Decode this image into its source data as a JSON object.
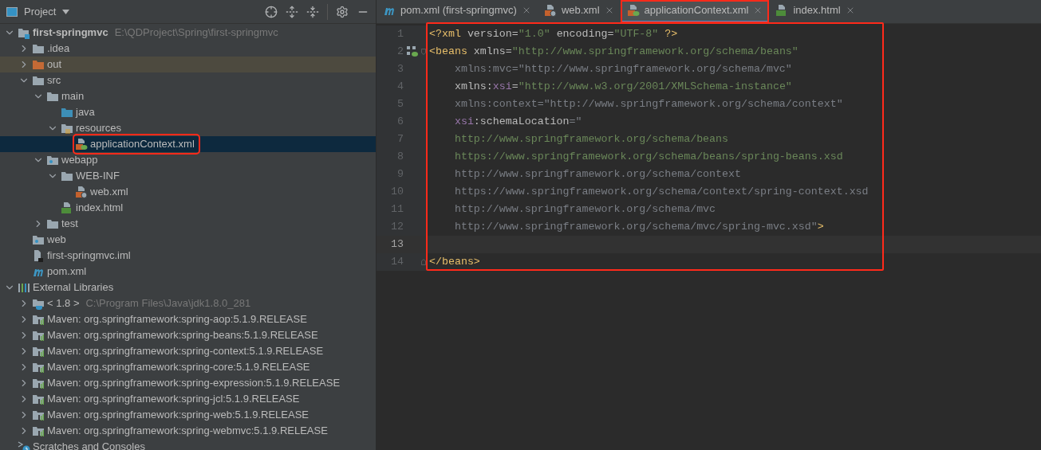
{
  "project_panel": {
    "title": "Project",
    "tree": [
      {
        "label": "first-springmvc",
        "detail": "E:\\QDProject\\Spring\\first-springmvc",
        "kind": "project",
        "bold": true,
        "expanded": true,
        "selected": false,
        "children": [
          {
            "label": ".idea",
            "kind": "folder",
            "expanded": false,
            "selected": false
          },
          {
            "label": "out",
            "kind": "folder-orange",
            "expanded": false,
            "excluded": true,
            "selected": false
          },
          {
            "label": "src",
            "kind": "folder",
            "expanded": true,
            "selected": false,
            "children": [
              {
                "label": "main",
                "kind": "folder",
                "expanded": true,
                "selected": false,
                "children": [
                  {
                    "label": "java",
                    "kind": "folder-blue",
                    "selected": false
                  },
                  {
                    "label": "resources",
                    "kind": "resources",
                    "expanded": true,
                    "selected": false,
                    "children": [
                      {
                        "label": "applicationContext.xml",
                        "kind": "xml-spring",
                        "selected": true,
                        "annotated": true
                      }
                    ]
                  }
                ]
              },
              {
                "label": "webapp",
                "kind": "web-folder",
                "expanded": true,
                "selected": false,
                "children": [
                  {
                    "label": "WEB-INF",
                    "kind": "folder",
                    "expanded": true,
                    "selected": false,
                    "children": [
                      {
                        "label": "web.xml",
                        "kind": "xml-web",
                        "selected": false
                      }
                    ]
                  },
                  {
                    "label": "index.html",
                    "kind": "html",
                    "selected": false
                  }
                ]
              },
              {
                "label": "test",
                "kind": "folder",
                "expanded": false,
                "selected": false
              }
            ]
          },
          {
            "label": "web",
            "kind": "web-folder",
            "selected": false
          },
          {
            "label": "first-springmvc.iml",
            "kind": "iml",
            "selected": false
          },
          {
            "label": "pom.xml",
            "kind": "maven",
            "selected": false
          }
        ]
      },
      {
        "label": "External Libraries",
        "kind": "libraries",
        "expanded": true,
        "selected": false,
        "children": [
          {
            "label": "< 1.8 >",
            "detail": "C:\\Program Files\\Java\\jdk1.8.0_281",
            "kind": "jdk",
            "expanded": false,
            "selected": false
          },
          {
            "label": "Maven: org.springframework:spring-aop:5.1.9.RELEASE",
            "kind": "library",
            "expanded": false,
            "selected": false
          },
          {
            "label": "Maven: org.springframework:spring-beans:5.1.9.RELEASE",
            "kind": "library",
            "expanded": false,
            "selected": false
          },
          {
            "label": "Maven: org.springframework:spring-context:5.1.9.RELEASE",
            "kind": "library",
            "expanded": false,
            "selected": false
          },
          {
            "label": "Maven: org.springframework:spring-core:5.1.9.RELEASE",
            "kind": "library",
            "expanded": false,
            "selected": false
          },
          {
            "label": "Maven: org.springframework:spring-expression:5.1.9.RELEASE",
            "kind": "library",
            "expanded": false,
            "selected": false
          },
          {
            "label": "Maven: org.springframework:spring-jcl:5.1.9.RELEASE",
            "kind": "library",
            "expanded": false,
            "selected": false
          },
          {
            "label": "Maven: org.springframework:spring-web:5.1.9.RELEASE",
            "kind": "library",
            "expanded": false,
            "selected": false
          },
          {
            "label": "Maven: org.springframework:spring-webmvc:5.1.9.RELEASE",
            "kind": "library",
            "expanded": false,
            "selected": false
          }
        ]
      },
      {
        "label": "Scratches and Consoles",
        "kind": "scratches",
        "selected": false
      }
    ]
  },
  "editor": {
    "annotated": true,
    "tabs": [
      {
        "label": "pom.xml (first-springmvc)",
        "kind": "maven",
        "selected": false,
        "annotated": false
      },
      {
        "label": "web.xml",
        "kind": "xml-web",
        "selected": false,
        "annotated": false
      },
      {
        "label": "applicationContext.xml",
        "kind": "xml-spring",
        "selected": true,
        "annotated": true
      },
      {
        "label": "index.html",
        "kind": "html",
        "selected": false,
        "annotated": false
      }
    ],
    "lines": [
      {
        "number": "1",
        "current": false,
        "tokens": [
          {
            "kind": "tag",
            "text": "<?xml "
          },
          {
            "kind": "attr",
            "text": "version="
          },
          {
            "kind": "value",
            "text": "\"1.0\" "
          },
          {
            "kind": "attr",
            "text": "encoding="
          },
          {
            "kind": "value",
            "text": "\"UTF-8\" "
          },
          {
            "kind": "tag",
            "text": "?>"
          }
        ]
      },
      {
        "number": "2",
        "current": false,
        "kind": "bean-start",
        "tokens": [
          {
            "kind": "tag",
            "text": "<beans "
          },
          {
            "kind": "attr",
            "text": "xmlns="
          },
          {
            "kind": "value",
            "text": "\"http://www.springframework.org/schema/beans\""
          }
        ]
      },
      {
        "number": "3",
        "current": false,
        "tokens": [
          {
            "kind": "unused",
            "text": "    xmlns:mvc=\"http://www.springframework.org/schema/mvc\""
          }
        ]
      },
      {
        "number": "4",
        "current": false,
        "tokens": [
          {
            "kind": "attr",
            "text": "    xmlns:"
          },
          {
            "kind": "ns",
            "text": "xsi"
          },
          {
            "kind": "attr",
            "text": "="
          },
          {
            "kind": "value",
            "text": "\"http://www.w3.org/2001/XMLSchema-instance\""
          }
        ]
      },
      {
        "number": "5",
        "current": false,
        "tokens": [
          {
            "kind": "unused",
            "text": "    xmlns:context=\"http://www.springframework.org/schema/context\""
          }
        ]
      },
      {
        "number": "6",
        "current": false,
        "tokens": [
          {
            "kind": "ns",
            "text": "    xsi"
          },
          {
            "kind": "attr",
            "text": ":schemaLocation"
          },
          {
            "kind": "unused",
            "text": "=\""
          }
        ]
      },
      {
        "number": "7",
        "current": false,
        "tokens": [
          {
            "kind": "value",
            "text": "    http://www.springframework.org/schema/beans"
          }
        ]
      },
      {
        "number": "8",
        "current": false,
        "tokens": [
          {
            "kind": "value",
            "text": "    https://www.springframework.org/schema/beans/spring-beans.xsd"
          }
        ]
      },
      {
        "number": "9",
        "current": false,
        "tokens": [
          {
            "kind": "unused",
            "text": "    http://www.springframework.org/schema/context"
          }
        ]
      },
      {
        "number": "10",
        "current": false,
        "tokens": [
          {
            "kind": "unused",
            "text": "    https://www.springframework.org/schema/context/spring-context.xsd"
          }
        ]
      },
      {
        "number": "11",
        "current": false,
        "tokens": [
          {
            "kind": "unused",
            "text": "    http://www.springframework.org/schema/mvc"
          }
        ]
      },
      {
        "number": "12",
        "current": false,
        "tokens": [
          {
            "kind": "unused",
            "text": "    http://www.springframework.org/schema/mvc/spring-mvc.xsd\""
          },
          {
            "kind": "tag",
            "text": ">"
          }
        ]
      },
      {
        "number": "13",
        "current": true
      },
      {
        "number": "14",
        "current": false,
        "kind": "block-end",
        "tokens": [
          {
            "kind": "tag",
            "text": "</beans>"
          }
        ]
      }
    ]
  }
}
